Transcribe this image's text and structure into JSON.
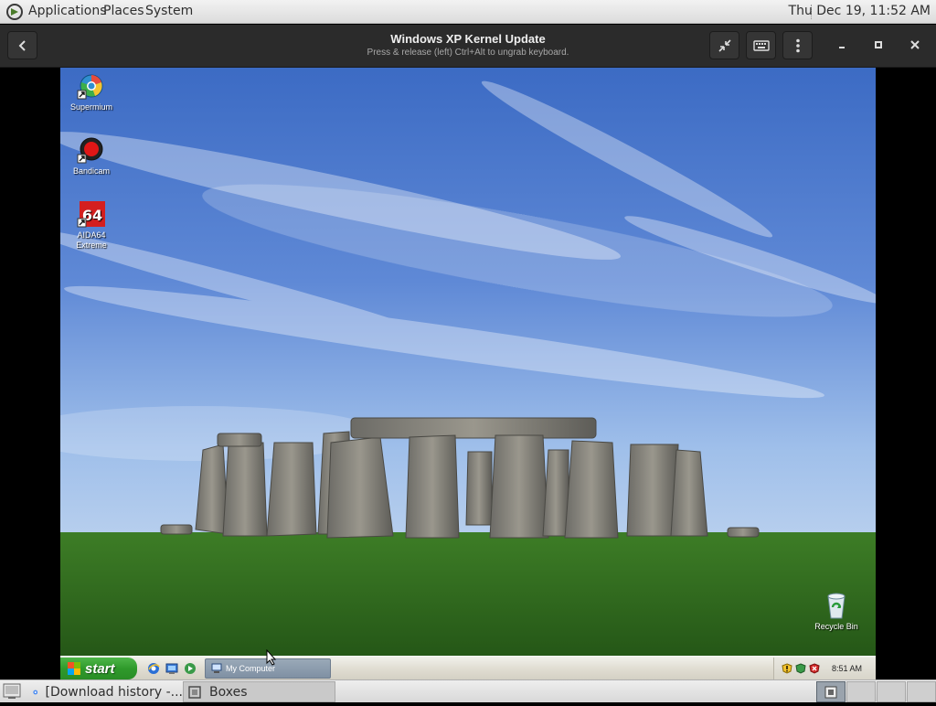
{
  "top_panel": {
    "menus": [
      "Applications",
      "Places",
      "System"
    ],
    "clock": "Thu Dec 19, 11:52 AM"
  },
  "boxes": {
    "title": "Windows XP Kernel Update",
    "subtitle": "Press & release (left) Ctrl+Alt to ungrab keyboard."
  },
  "desktop": {
    "icons": [
      {
        "label": "Supermium",
        "icon": "supermium-browser-icon"
      },
      {
        "label": "Bandicam",
        "icon": "bandicam-icon"
      },
      {
        "label_line1": "AIDA64",
        "label_line2": "Extreme",
        "icon": "aida64-icon",
        "badge": "64"
      },
      {
        "label": "Recycle Bin",
        "icon": "recycle-bin-icon"
      }
    ],
    "colors": {
      "sky_top": "#3c6bc4",
      "grass": "#2f6b1f",
      "stone": "#8a8880"
    }
  },
  "xp_taskbar": {
    "start_label": "start",
    "task_button": "My Computer",
    "tray_time": "8:51 AM"
  },
  "bottom_panel": {
    "tasks": [
      "[Download history -...",
      "Boxes"
    ]
  }
}
